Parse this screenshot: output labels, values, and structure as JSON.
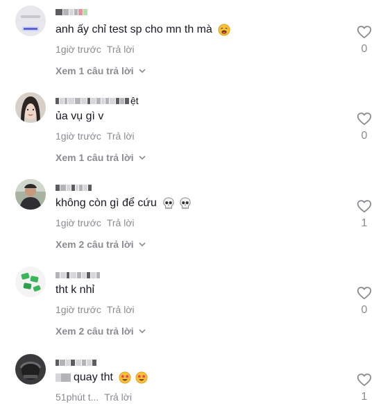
{
  "comments": [
    {
      "text": "anh ấy chỉ test sp cho mn th mà",
      "time": "1giờ trước",
      "reply": "Trả lời",
      "view": "Xem 1 câu trả lời",
      "likes": "0",
      "emojis": [
        "weary-face-icon"
      ]
    },
    {
      "name_tail": "ệt",
      "text": "ủa vụ gì v",
      "time": "1giờ trước",
      "reply": "Trả lời",
      "view": "Xem 1 câu trả lời",
      "likes": "0",
      "emojis": []
    },
    {
      "text": "không còn gì để cứu",
      "time": "1giờ trước",
      "reply": "Trả lời",
      "view": "Xem 2 câu trả lời",
      "likes": "1",
      "emojis": [
        "skull-icon",
        "skull-icon"
      ]
    },
    {
      "text": "tht k nhỉ",
      "time": "1giờ trước",
      "reply": "Trả lời",
      "view": "Xem 2 câu trả lời",
      "likes": "0",
      "emojis": []
    },
    {
      "text": "quay tht",
      "time": "51phút t...",
      "reply": "Trả lời",
      "likes": "1",
      "emojis": [
        "star-struck-icon",
        "star-struck-icon"
      ]
    }
  ],
  "colors": {
    "text": "#161823",
    "muted": "#8a8b91",
    "background": "#ffffff"
  }
}
